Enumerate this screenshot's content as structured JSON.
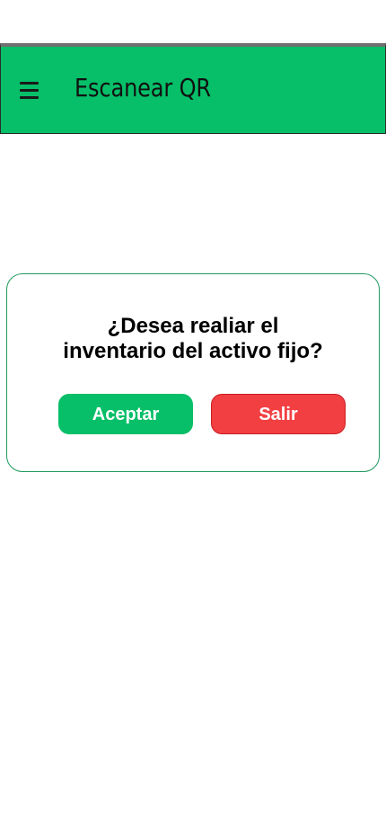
{
  "header": {
    "title": "Escanear QR",
    "menu_icon": "hamburger-menu-icon"
  },
  "dialog": {
    "question_line1": "¿Desea realiar el",
    "question_line2": "inventario del activo fijo?",
    "accept_label": "Aceptar",
    "exit_label": "Salir"
  },
  "colors": {
    "header_bg": "#06bf68",
    "accept_bg": "#06bf68",
    "exit_bg": "#f23f42",
    "dialog_border": "#1f9a5e"
  }
}
